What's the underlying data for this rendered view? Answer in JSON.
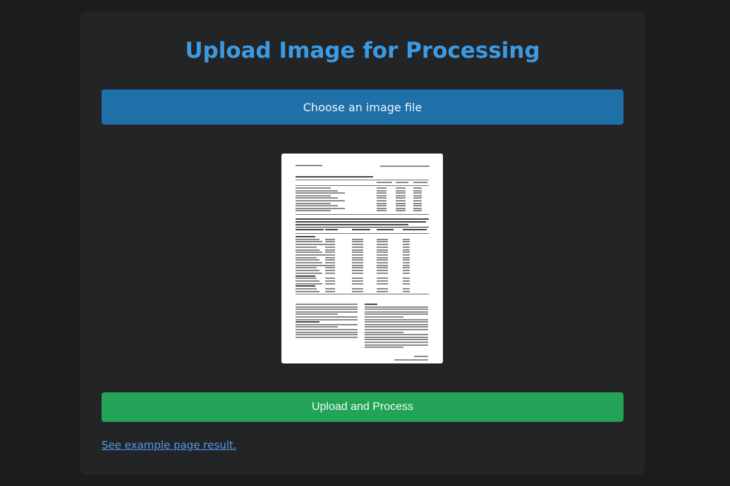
{
  "page": {
    "title": "Upload Image for Processing"
  },
  "upload": {
    "choose_label": "Choose an image file"
  },
  "actions": {
    "process_label": "Upload and Process",
    "example_link": "See example  page result."
  },
  "colors": {
    "title": "#3b9ae1",
    "choose_button": "#1f6fa8",
    "process_button": "#23a357",
    "link": "#4f9df0",
    "background": "#1b1c1e",
    "card": "#232426"
  }
}
